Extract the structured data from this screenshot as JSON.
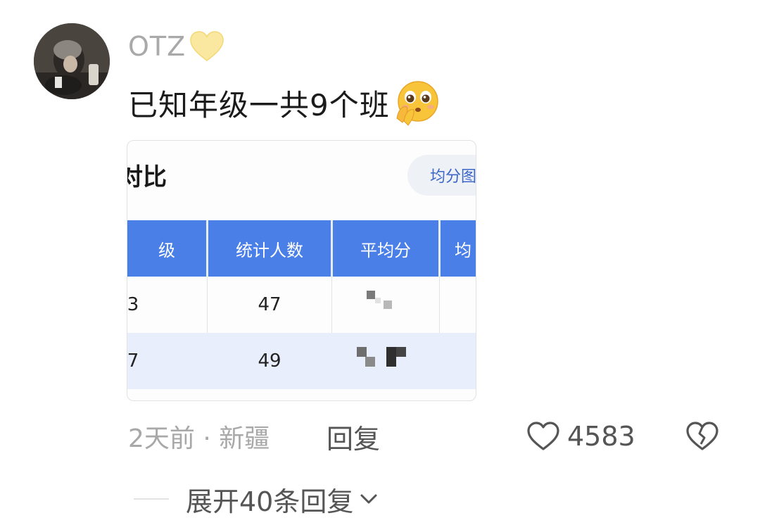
{
  "comment": {
    "username": "OTZ",
    "username_badge_icon": "yellow-heart-icon",
    "text": "已知年级一共9个班",
    "emoji": "pleading-face-emoji",
    "time_location": "2天前 · 新疆",
    "reply_label": "回复",
    "like_count": "4583",
    "expand_replies_label": "展开40条回复"
  },
  "attached_image": {
    "title_fragment": "对比",
    "pill_label": "均分图",
    "table": {
      "headers": [
        "级",
        "统计人数",
        "平均分",
        "均"
      ],
      "rows": [
        {
          "class_fragment": "3",
          "count": "47"
        },
        {
          "class_fragment": "7",
          "count": "49"
        }
      ]
    }
  },
  "colors": {
    "table_header_bg": "#4b7fe8",
    "alt_row_bg": "#e8eefb",
    "pill_text": "#3c67c9",
    "muted_text": "#a8a8a8"
  }
}
